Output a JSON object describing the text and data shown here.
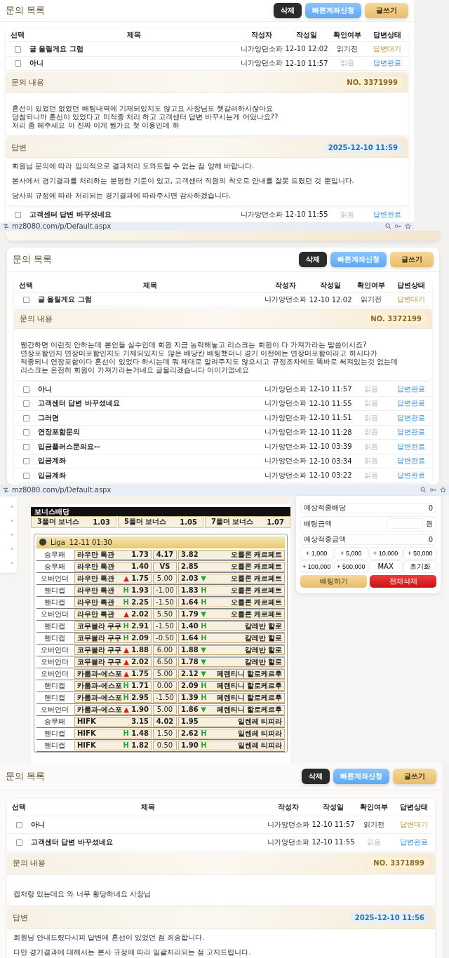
{
  "screens": [
    {
      "kind": "inquiry",
      "framed": false,
      "title": "문의 목록",
      "buttons": [
        {
          "label": "삭제",
          "kind": "dark"
        },
        {
          "label": "빠른계좌신청",
          "kind": "blue"
        },
        {
          "label": "글쓰기",
          "kind": "gold"
        }
      ],
      "columns": [
        "선택",
        "제목",
        "작성자",
        "작성일",
        "확인여부",
        "답변상태"
      ],
      "items": [
        {
          "kind": "row",
          "checked": false,
          "title": "글 올릴게요 그럼",
          "author": "니가앙던소파",
          "date": "12-10 12:02",
          "read": false,
          "read_status": "읽기전",
          "answered": false,
          "answer_status": "답변대기"
        },
        {
          "kind": "row",
          "checked": false,
          "title": "아니",
          "author": "니가앙던소파",
          "date": "12-10 11:57",
          "read": true,
          "read_status": "읽음",
          "answered": true,
          "answer_status": "답변완료"
        },
        {
          "kind": "detail",
          "title": "문의 내용",
          "number": "NO. 3371999",
          "lines": [
            "혼선이 있었던 없었던 배팅내역에 기재되있지도 않고요 사장님도 헷갈려하시잖아요",
            "당첨되니까 혼선이 있었다고 미적중 처리 하고 고객센터 답변 바꾸시는게 어딨나요??",
            "처리 좀 해주세요 아 진짜 이게 뭔가요 첫 이용인데 하"
          ]
        },
        {
          "kind": "answer",
          "title": "답변",
          "date": "2025-12-10 11:59",
          "paragraphs": [
            "회원님 문의에 따라 임의적으로 결과처리 도와드릴 수 없는 점 양해 바랍니다.",
            "본사에서 경기결과를 처리하는 분명한 기준이 있고, 고객센터 직원의 착오로 안내를 잘못 드렸던 것 뿐입니다.",
            "당사의 규정에 따라 처리되는 경기결과에 따라주시면 감사하겠습니다."
          ]
        },
        {
          "kind": "row",
          "checked": false,
          "title": "고객센터 답변 바꾸셨네요",
          "author": "니가앙던소파",
          "date": "12-10 11:55",
          "read": true,
          "read_status": "읽음",
          "answered": true,
          "answer_status": "답변완료"
        }
      ],
      "address_bar": "mz8080.com/p/Default.aspx"
    },
    {
      "kind": "inquiry",
      "framed": true,
      "title": "문의 목록",
      "buttons": [
        {
          "label": "삭제",
          "kind": "dark"
        },
        {
          "label": "빠른계좌신청",
          "kind": "blue"
        },
        {
          "label": "글쓰기",
          "kind": "gold"
        }
      ],
      "columns": [
        "선택",
        "제목",
        "작성자",
        "작성일",
        "확인여부",
        "답변상태"
      ],
      "items": [
        {
          "kind": "row",
          "checked": false,
          "title": "글 올릴게요 그럼",
          "author": "니가앙던소파",
          "date": "12-10 12:02",
          "read": false,
          "read_status": "읽기전",
          "answered": false,
          "answer_status": "답변대기"
        },
        {
          "kind": "detail",
          "title": "문의 내용",
          "number": "NO. 3372199",
          "lines": [
            "웬간하면 이런짓 안하는데 본인들 실수인데 회원 지금 농락해놓고 리스크는 회원이 다 가져가라는 말씀이시죠?",
            "연장포함인지 연장미포함인지도 기재되있지도 않은 배당칸 배팅했더니 경기 이전에는 연장미포함이라고 하시다가",
            "적중되니 연장포함이다 혼선이 있었다 하시는데 뭐 제대로 알려주지도 않으시고 규정조차에도 똑바로 써져있는것 없는데",
            "리스크는 온전히 회원이 가져가라는거네요 글올리겠습니다 어이가없네요"
          ]
        },
        {
          "kind": "row",
          "checked": false,
          "title": "아니",
          "author": "니가앙던소파",
          "date": "12-10 11:57",
          "read": true,
          "read_status": "읽음",
          "answered": true,
          "answer_status": "답변완료"
        },
        {
          "kind": "row",
          "checked": false,
          "title": "고객센터 답변 바꾸셨네요",
          "author": "니가앙던소파",
          "date": "12-10 11:55",
          "read": true,
          "read_status": "읽음",
          "answered": true,
          "answer_status": "답변완료"
        },
        {
          "kind": "row",
          "checked": false,
          "title": "그러면",
          "author": "니가앙던소파",
          "date": "12-10 11:51",
          "read": true,
          "read_status": "읽음",
          "answered": true,
          "answer_status": "답변완료"
        },
        {
          "kind": "row",
          "checked": false,
          "title": "연장포함문의",
          "author": "니가앙던소파",
          "date": "12-10 11:28",
          "read": true,
          "read_status": "읽음",
          "answered": true,
          "answer_status": "답변완료"
        },
        {
          "kind": "row",
          "checked": false,
          "title": "입금플러스문의요--",
          "author": "니가앙던소파",
          "date": "12-10 03:39",
          "read": true,
          "read_status": "읽음",
          "answered": true,
          "answer_status": "답변완료"
        },
        {
          "kind": "row",
          "checked": false,
          "title": "입금계좌",
          "author": "니가앙던소파",
          "date": "12-10 03:34",
          "read": true,
          "read_status": "읽음",
          "answered": true,
          "answer_status": "답변완료"
        },
        {
          "kind": "row",
          "checked": false,
          "title": "입금계좌",
          "author": "니가앙던소파",
          "date": "12-10 03:22",
          "read": true,
          "read_status": "읽음",
          "answered": true,
          "answer_status": "답변완료"
        }
      ],
      "address_bar": "mz8080.com/p/Default.aspx"
    },
    {
      "kind": "betting",
      "bonus": {
        "title": "보너스배당",
        "items": [
          {
            "label": "3폴더 보너스",
            "odds": "1.03"
          },
          {
            "label": "5폴더 보너스",
            "odds": "1.05"
          },
          {
            "label": "7폴더 보너스",
            "odds": "1.07"
          }
        ]
      },
      "league": {
        "name": "Liga",
        "time": "12-11 01:30"
      },
      "rows": [
        {
          "kind": "winner",
          "market": "승무패",
          "home": "라우만 톡관",
          "home_odds": "1.73",
          "line": "4.17",
          "away_odds": "3.82",
          "away": "오를론 캐르페트"
        },
        {
          "kind": "winner",
          "market": "승무패",
          "home": "라우만 톡관",
          "home_odds": "1.40",
          "line": "VS",
          "away_odds": "2.85",
          "away": "오를론 캐르페트"
        },
        {
          "kind": "ou",
          "market": "오버언더",
          "home": "라우만 톡관",
          "home_mark": "▲",
          "home_odds": "1.75",
          "line": "5.00",
          "away_odds": "2.03",
          "away_mark": "▼",
          "away": "오를론 캐르페트"
        },
        {
          "kind": "hcp",
          "market": "핸디캡",
          "home": "라우만 톡관",
          "home_mark": "H",
          "home_odds": "1.93",
          "line": "-1.00",
          "away_odds": "1.83",
          "away_mark": "H",
          "away": "오를론 캐르페트"
        },
        {
          "kind": "hcp",
          "market": "핸디캡",
          "home": "라우만 톡관",
          "home_mark": "H",
          "home_odds": "2.25",
          "line": "-1.50",
          "away_odds": "1.64",
          "away_mark": "H",
          "away": "오를론 캐르페트"
        },
        {
          "kind": "ou",
          "market": "오버언더",
          "home": "라우만 톡관",
          "home_mark": "▲",
          "home_odds": "2.02",
          "line": "5.50",
          "away_odds": "1.79",
          "away_mark": "▼",
          "away": "오를론 캐르페트"
        },
        {
          "kind": "hcp",
          "market": "핸디캡",
          "home": "코무볼라 쿠쿠",
          "home_mark": "H",
          "home_odds": "2.91",
          "line": "-1.50",
          "away_odds": "1.40",
          "away_mark": "H",
          "away": "칼레반 할로"
        },
        {
          "kind": "hcp",
          "market": "핸디캡",
          "home": "코무볼라 쿠쿠",
          "home_mark": "H",
          "home_odds": "2.09",
          "line": "-0.50",
          "away_odds": "1.64",
          "away_mark": "H",
          "away": "칼레반 할로"
        },
        {
          "kind": "ou",
          "market": "오버언더",
          "home": "코무볼라 쿠쿠",
          "home_mark": "▲",
          "home_odds": "1.88",
          "line": "6.00",
          "away_odds": "1.88",
          "away_mark": "▼",
          "away": "칼레반 할로"
        },
        {
          "kind": "ou",
          "market": "오버언더",
          "home": "코무볼라 쿠쿠",
          "home_mark": "▲",
          "home_odds": "2.02",
          "line": "6.50",
          "away_odds": "1.78",
          "away_mark": "▼",
          "away": "칼레반 할로"
        },
        {
          "kind": "ou",
          "market": "오버언더",
          "home": "카룸과-에스포",
          "home_mark": "▲",
          "home_odds": "1.75",
          "line": "5.00",
          "away_odds": "2.12",
          "away_mark": "▼",
          "away": "페렌티니 할로케르후"
        },
        {
          "kind": "hcp",
          "market": "핸디캡",
          "home": "카룸과-에스포",
          "home_mark": "H",
          "home_odds": "1.71",
          "line": "0.00",
          "away_odds": "2.09",
          "away_mark": "H",
          "away": "페렌티니 할로케르후"
        },
        {
          "kind": "hcp",
          "market": "핸디캡",
          "home": "카룸과-에스포",
          "home_mark": "H",
          "home_odds": "2.95",
          "line": "-1.50",
          "away_odds": "1.39",
          "away_mark": "H",
          "away": "페렌티니 할로케르후"
        },
        {
          "kind": "ou",
          "market": "오버언더",
          "home": "카룸과-에스포",
          "home_mark": "▲",
          "home_odds": "1.90",
          "line": "5.00",
          "away_odds": "1.86",
          "away_mark": "▼",
          "away": "페렌티니 할로케르후"
        },
        {
          "kind": "winner",
          "market": "승무패",
          "home": "HIFK",
          "home_odds": "3.15",
          "line": "4.02",
          "away_odds": "1.95",
          "away": "일렌레 티피라"
        },
        {
          "kind": "hcp",
          "market": "핸디캡",
          "home": "HIFK",
          "home_mark": "H",
          "home_odds": "1.48",
          "line": "1.50",
          "away_odds": "2.62",
          "away_mark": "H",
          "away": "일렌레 티피라"
        },
        {
          "kind": "hcp",
          "market": "핸디캡",
          "home": "HIFK",
          "home_mark": "H",
          "home_odds": "1.82",
          "line": "0.50",
          "away_odds": "1.90",
          "away_mark": "H",
          "away": "일렌레 티피라"
        }
      ],
      "slip": {
        "rows": [
          {
            "kind": "value",
            "label": "예상적중배당",
            "value": "0"
          },
          {
            "kind": "input",
            "label": "배팅금액",
            "unit": "원"
          },
          {
            "kind": "value",
            "label": "예상적중금액",
            "value": "0"
          }
        ],
        "chips": [
          "+ 1,000",
          "+ 5,000",
          "+ 10,000",
          "+ 50,000",
          "+ 100,000",
          "+ 500,000",
          "MAX",
          "초기화"
        ],
        "actions": [
          {
            "label": "배팅하기",
            "kind": "gold"
          },
          {
            "label": "전체삭제",
            "kind": "red"
          }
        ]
      }
    },
    {
      "kind": "inquiry",
      "framed": false,
      "title": "문의 목록",
      "buttons": [
        {
          "label": "삭제",
          "kind": "dark"
        },
        {
          "label": "빠른계좌신청",
          "kind": "blue"
        },
        {
          "label": "글쓰기",
          "kind": "gold"
        }
      ],
      "columns": [
        "선택",
        "제목",
        "작성자",
        "작성일",
        "확인여부",
        "답변상태"
      ],
      "items": [
        {
          "kind": "row",
          "checked": false,
          "title": "아니",
          "author": "니가앙던소파",
          "date": "12-10 11:57",
          "read": false,
          "read_status": "읽기전",
          "answered": false,
          "answer_status": "답변대기"
        },
        {
          "kind": "row",
          "checked": false,
          "title": "고객센터 답변 바꾸셨네요",
          "author": "니가앙던소파",
          "date": "12-10 11:55",
          "read": true,
          "read_status": "읽음",
          "answered": true,
          "answer_status": "답변완료"
        },
        {
          "kind": "detail",
          "title": "문의 내용",
          "number": "NO. 3371899",
          "lines": [
            "캡처랑 있는데요 와 너무 황당하네요 사장님"
          ]
        },
        {
          "kind": "answer",
          "title": "답변",
          "date": "2025-12-10 11:56",
          "paragraphs": [
            "회원님 안내드렸다시피 답변에 혼선이 있었던 점 죄송합니다.",
            "다만 경기결과에 대해서는 본사 규정에 따라 일괄처리되는 점 고지드립니다."
          ]
        }
      ]
    }
  ]
}
